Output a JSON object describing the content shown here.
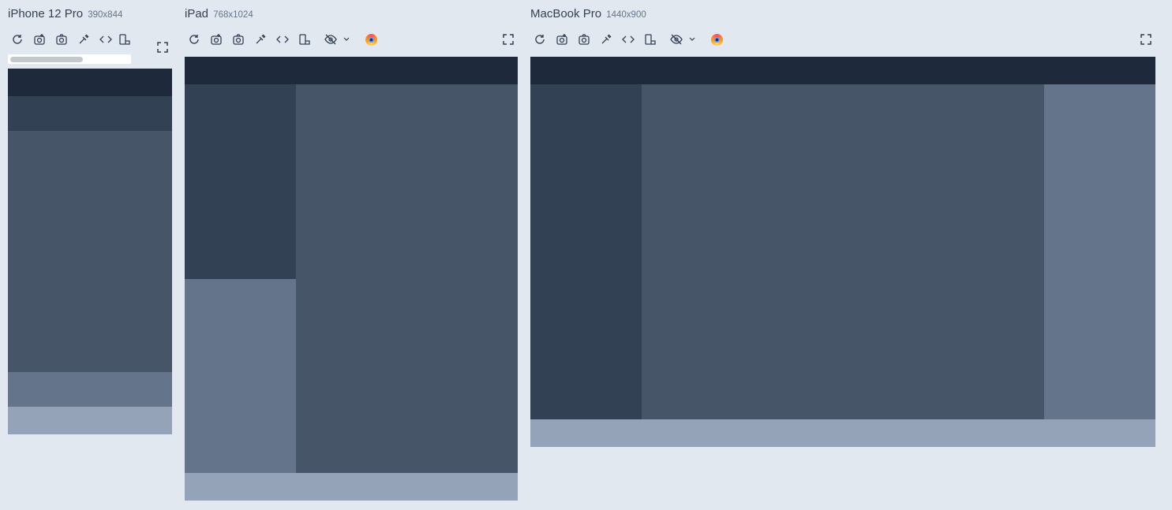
{
  "devices": [
    {
      "name": "iPhone 12 Pro",
      "dims": "390x844"
    },
    {
      "name": "iPad",
      "dims": "768x1024"
    },
    {
      "name": "MacBook Pro",
      "dims": "1440x900"
    }
  ],
  "colors": {
    "page_bg": "#e2e8f0",
    "header": "#1e293b",
    "sidebar": "#334155",
    "main": "#475569",
    "aside": "#64748b",
    "footer": "#94a3b8",
    "toolbar_icon": "#334155"
  },
  "toolbar_icons": [
    "reload-icon",
    "screenshot-full-icon",
    "camera-icon",
    "eyedropper-icon",
    "code-icon",
    "rotate-device-icon",
    "hide-eye-icon",
    "chevron-down-icon",
    "firefox-icon",
    "fullscreen-icon"
  ],
  "iphone": {
    "scroll_fraction": 0.6
  }
}
